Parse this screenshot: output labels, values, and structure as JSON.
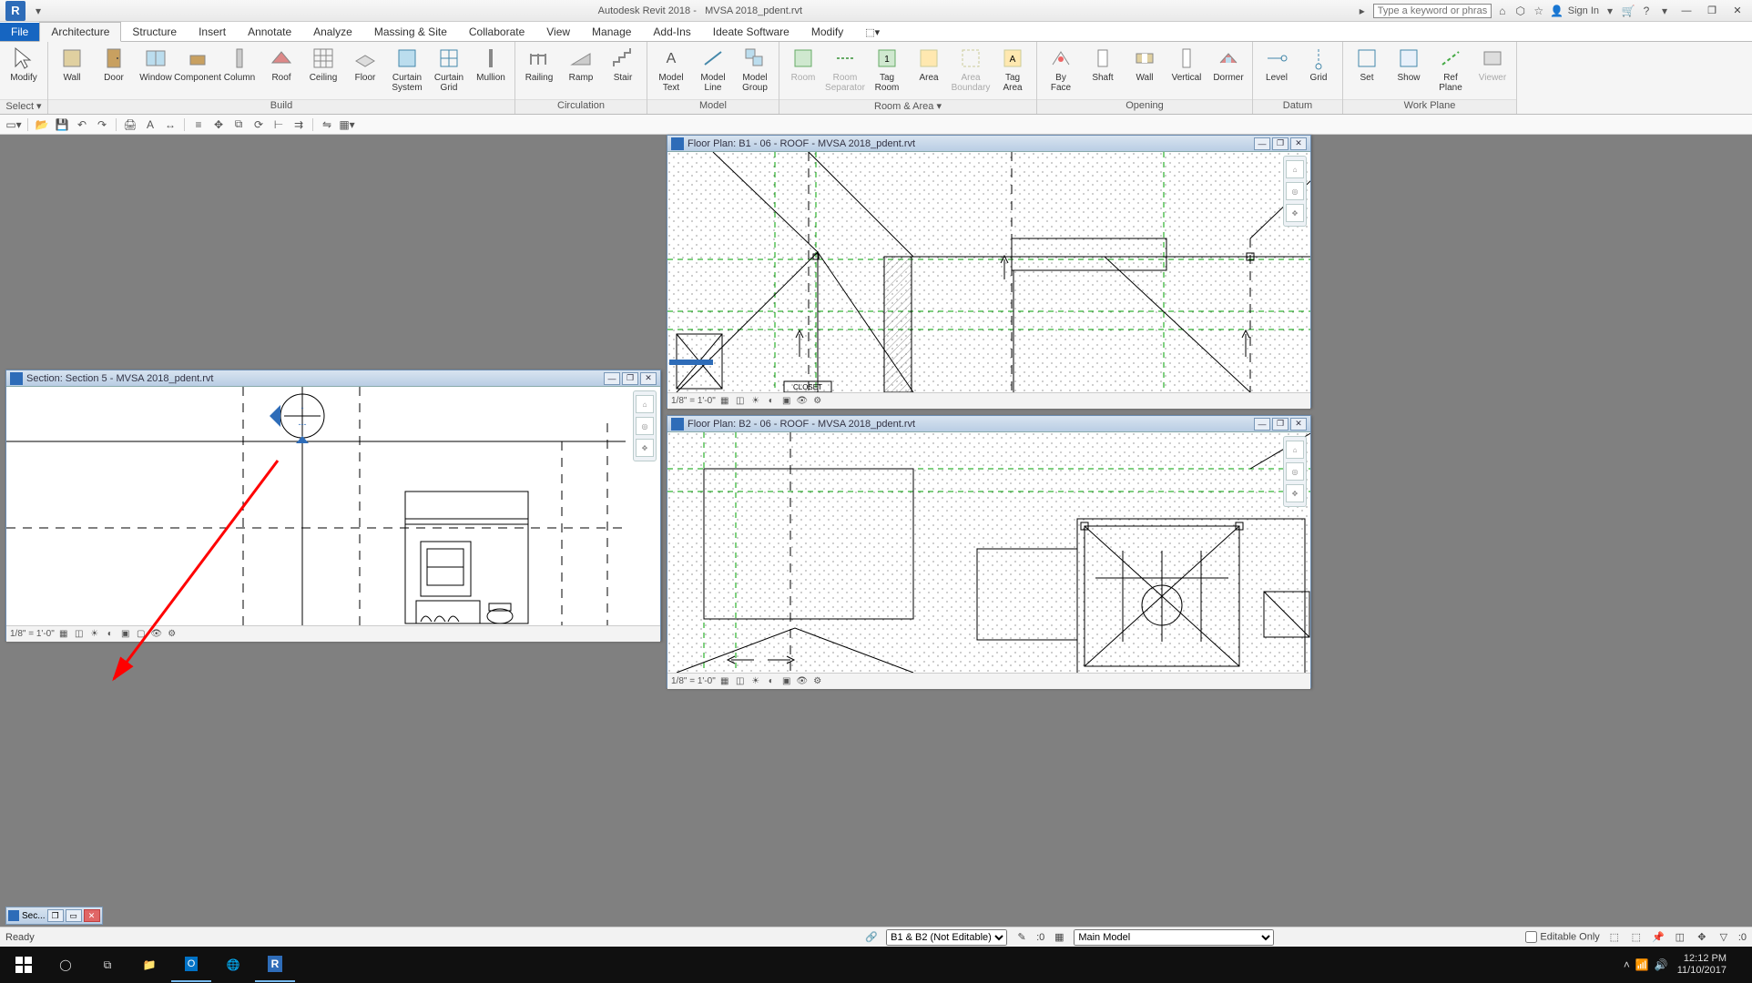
{
  "title": {
    "app": "Autodesk Revit 2018 -",
    "doc": "MVSA 2018_pdent.rvt"
  },
  "search": {
    "placeholder": "Type a keyword or phrase"
  },
  "signin": "Sign In",
  "tabs": [
    "File",
    "Architecture",
    "Structure",
    "Insert",
    "Annotate",
    "Analyze",
    "Massing & Site",
    "Collaborate",
    "View",
    "Manage",
    "Add-Ins",
    "Ideate Software",
    "Modify"
  ],
  "ribbon": {
    "panels": [
      {
        "label": "Select ▾",
        "tools": [
          {
            "l": "Modify",
            "i": "cursor"
          }
        ]
      },
      {
        "label": "Build",
        "tools": [
          {
            "l": "Wall",
            "i": "wall"
          },
          {
            "l": "Door",
            "i": "door"
          },
          {
            "l": "Window",
            "i": "window"
          },
          {
            "l": "Component",
            "i": "comp"
          },
          {
            "l": "Column",
            "i": "col"
          },
          {
            "l": "Roof",
            "i": "roof"
          },
          {
            "l": "Ceiling",
            "i": "ceil"
          },
          {
            "l": "Floor",
            "i": "floor"
          },
          {
            "l": "Curtain System",
            "i": "cs"
          },
          {
            "l": "Curtain Grid",
            "i": "cg"
          },
          {
            "l": "Mullion",
            "i": "mul"
          }
        ]
      },
      {
        "label": "Circulation",
        "tools": [
          {
            "l": "Railing",
            "i": "rail"
          },
          {
            "l": "Ramp",
            "i": "ramp"
          },
          {
            "l": "Stair",
            "i": "stair"
          }
        ]
      },
      {
        "label": "Model",
        "tools": [
          {
            "l": "Model Text",
            "i": "mt"
          },
          {
            "l": "Model Line",
            "i": "ml"
          },
          {
            "l": "Model Group",
            "i": "mg"
          }
        ]
      },
      {
        "label": "Room & Area ▾",
        "tools": [
          {
            "l": "Room",
            "i": "room",
            "d": true
          },
          {
            "l": "Room Separator",
            "i": "rsep",
            "d": true
          },
          {
            "l": "Tag Room",
            "i": "troom"
          },
          {
            "l": "Area",
            "i": "area"
          },
          {
            "l": "Area Boundary",
            "i": "ab",
            "d": true
          },
          {
            "l": "Tag Area",
            "i": "tarea"
          }
        ]
      },
      {
        "label": "Opening",
        "tools": [
          {
            "l": "By Face",
            "i": "bf"
          },
          {
            "l": "Shaft",
            "i": "shaft"
          },
          {
            "l": "Wall",
            "i": "owall"
          },
          {
            "l": "Vertical",
            "i": "vert"
          },
          {
            "l": "Dormer",
            "i": "dorm"
          }
        ]
      },
      {
        "label": "Datum",
        "tools": [
          {
            "l": "Level",
            "i": "lvl"
          },
          {
            "l": "Grid",
            "i": "grid"
          }
        ]
      },
      {
        "label": "Work Plane",
        "tools": [
          {
            "l": "Set",
            "i": "set"
          },
          {
            "l": "Show",
            "i": "show"
          },
          {
            "l": "Ref Plane",
            "i": "ref"
          },
          {
            "l": "Viewer",
            "i": "viewer",
            "d": true
          }
        ]
      }
    ]
  },
  "views": {
    "v1": {
      "title": "Section: Section 5 - MVSA 2018_pdent.rvt",
      "scale": "1/8\" = 1'-0\""
    },
    "v2": {
      "title": "Floor Plan: B1 - 06 - ROOF - MVSA 2018_pdent.rvt",
      "scale": "1/8\" = 1'-0\"",
      "text1": "CLOSET"
    },
    "v3": {
      "title": "Floor Plan: B2 - 06 - ROOF - MVSA 2018_pdent.rvt",
      "scale": "1/8\" = 1'-0\""
    }
  },
  "minview": "Sec...",
  "status": {
    "ready": "Ready",
    "workset": "B1 & B2 (Not Editable)",
    "sel": ":0",
    "model": "Main Model",
    "editable": "Editable Only",
    "filter": ":0"
  },
  "clock": {
    "time": "12:12 PM",
    "date": "11/10/2017"
  }
}
